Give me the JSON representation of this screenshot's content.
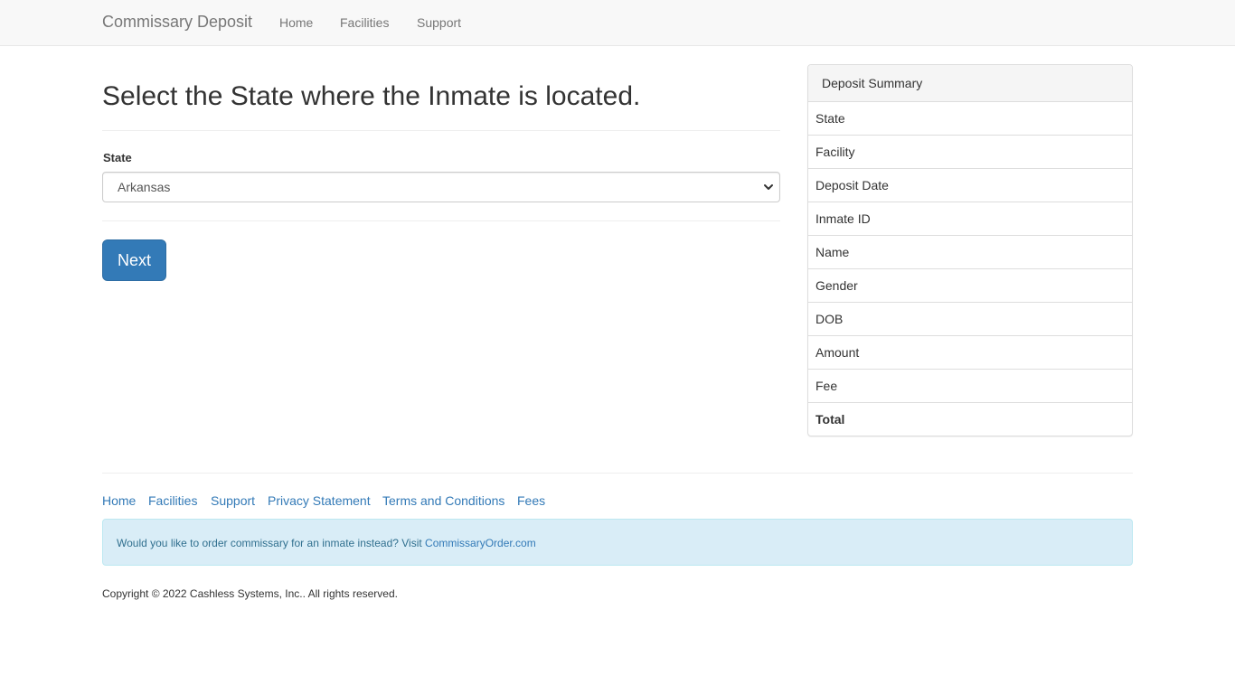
{
  "navbar": {
    "brand": "Commissary Deposit",
    "links": [
      "Home",
      "Facilities",
      "Support"
    ]
  },
  "main": {
    "title": "Select the State where the Inmate is located.",
    "state_label": "State",
    "state_selected": "Arkansas",
    "next_button": "Next"
  },
  "summary": {
    "heading": "Deposit Summary",
    "rows": [
      "State",
      "Facility",
      "Deposit Date",
      "Inmate ID",
      "Name",
      "Gender",
      "DOB",
      "Amount",
      "Fee",
      "Total"
    ]
  },
  "footer": {
    "links": [
      "Home",
      "Facilities",
      "Support",
      "Privacy Statement",
      "Terms and Conditions",
      "Fees"
    ],
    "alert_text": "Would you like to order commissary for an inmate instead? Visit ",
    "alert_link": "CommissaryOrder.com",
    "copyright": "Copyright © 2022 Cashless Systems, Inc.. All rights reserved."
  },
  "colors": {
    "primary": "#337ab7",
    "navbar_bg": "#f8f8f8",
    "alert_bg": "#d9edf7",
    "alert_text": "#31708f"
  },
  "icons": {
    "select_arrow": "chevron-down-icon"
  }
}
